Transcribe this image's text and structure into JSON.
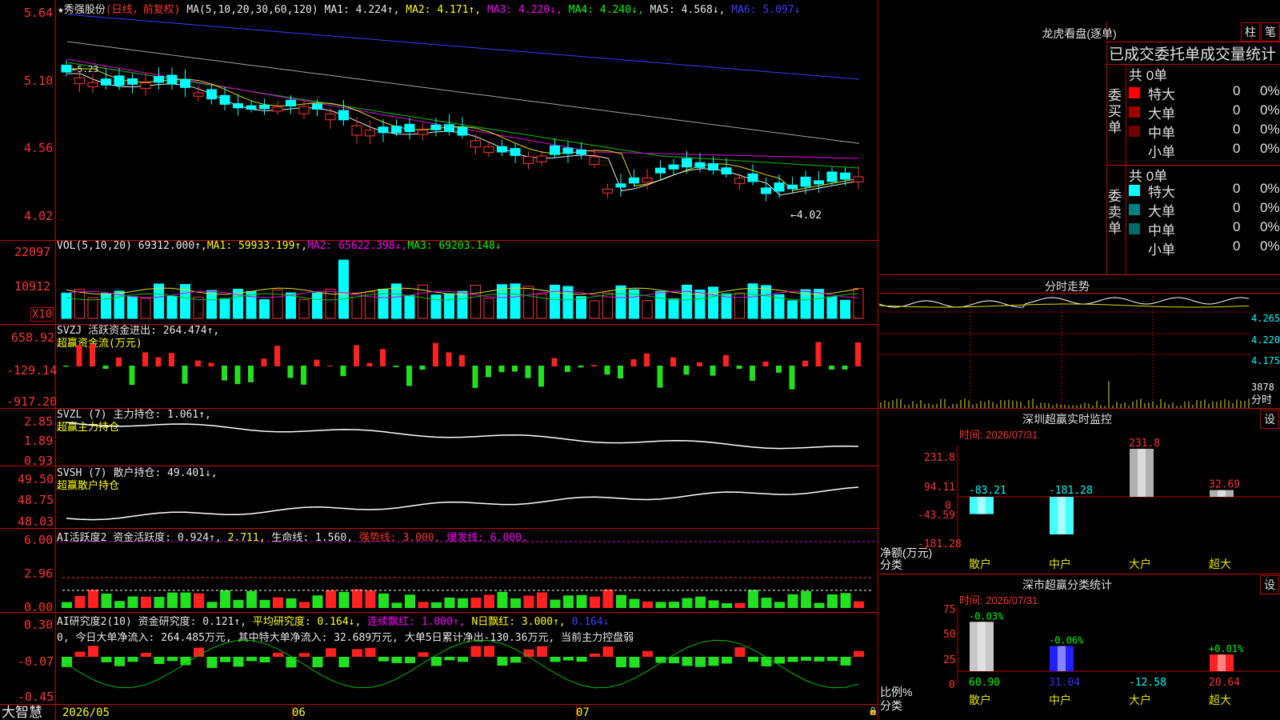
{
  "stock": {
    "name": "秀强股份",
    "mode": "(日线，前复权)",
    "ma_prefix": "MA(5,10,20,30,60,120)",
    "ma1": "MA1: 4.224↑,",
    "ma2": "MA2: 4.171↑,",
    "ma3": "MA3: 4.220↓,",
    "ma4": "MA4: 4.240↓,",
    "ma5": "MA5: 4.568↓,",
    "ma6": "MA6: 5.097↓",
    "arrow_label": "←4.02",
    "hi_label": "←5.23"
  },
  "price_axis": {
    "ticks": [
      "5.64",
      "5.10",
      "4.56",
      "4.02"
    ]
  },
  "vol": {
    "prefix": "VOL(5,10,20)",
    "value": "69312.000↑,",
    "ma1": "MA1: 59933.199↑,",
    "ma2": "MA2: 65622.398↓,",
    "ma3": "MA3: 69203.148↓",
    "ticks": [
      "22097",
      "10912"
    ],
    "unit": "X10"
  },
  "svzj": {
    "line1": "SVZJ  活跃资金进出: 264.474↑,",
    "line2": "超赢资金流(万元)",
    "ticks": [
      "658.92",
      "-129.14",
      "-917.20"
    ]
  },
  "svzl": {
    "line1": "SVZL (7) 主力持仓: 1.061↑,",
    "line2": "超赢主力持仓",
    "ticks": [
      "2.85",
      "1.89",
      "0.93"
    ]
  },
  "svsh": {
    "line1": "SVSH (7) 散户持仓: 49.401↓,",
    "line2": "超赢散户持仓",
    "ticks": [
      "49.50",
      "48.75",
      "48.03"
    ]
  },
  "ai1": {
    "a": "AI活跃度2 资金活跃度: 0.924↑,",
    "b": "2.711,",
    "c": "生命线: 1.560,",
    "d": "强势线: 3.000,",
    "e": "爆发线: 6.000,",
    "ticks": [
      "6.00",
      "2.96",
      "0.00"
    ]
  },
  "ai2": {
    "a": "AI研究度2(10) 资金研究度: 0.121↑,",
    "b": "平均研究度: 0.164↓,",
    "c": "连续飘红: 1.000↑,",
    "d": "N日飘红: 3.000↑,",
    "e": "0.164↓",
    "summary": "0, 今日大单净流入: 264.485万元, 其中特大单净流入: 32.689万元, 大单5日累计净出-130.36万元, 当前主力控盘弱",
    "ticks": [
      "0.30",
      "-0.07",
      "-0.45"
    ]
  },
  "dates": [
    "2026/05",
    "06",
    "07"
  ],
  "brand": "大智慧",
  "lhb": {
    "title": "龙虎看盘(逐单)",
    "btn1": "柱",
    "btn2": "笔",
    "header": "已成交委托单成交量统计",
    "buy_label": "委买单",
    "sell_label": "委卖单",
    "buy_total": "共 0单",
    "sell_total": "共 0单",
    "buy_rows": [
      {
        "name": "特大",
        "count": "0",
        "pct": "0%",
        "color": "#ff0000"
      },
      {
        "name": "大单",
        "count": "0",
        "pct": "0%",
        "color": "#a00000"
      },
      {
        "name": "中单",
        "count": "0",
        "pct": "0%",
        "color": "#700000"
      },
      {
        "name": "小单",
        "count": "0",
        "pct": "0%",
        "color": ""
      }
    ],
    "sell_rows": [
      {
        "name": "特大",
        "count": "0",
        "pct": "0%",
        "color": "#00ffff"
      },
      {
        "name": "大单",
        "count": "0",
        "pct": "0%",
        "color": "#008080"
      },
      {
        "name": "中单",
        "count": "0",
        "pct": "0%",
        "color": "#006868"
      },
      {
        "name": "小单",
        "count": "0",
        "pct": "0%",
        "color": ""
      }
    ]
  },
  "fenshi": {
    "title": "分时走势",
    "ticks": [
      "4.265",
      "4.220",
      "4.175"
    ],
    "vol": "3878",
    "vol_label": "分时"
  },
  "monitor": {
    "title": "深圳超赢实时监控",
    "btn": "设",
    "time": "时间: 2026/07/31",
    "ticks": [
      "231.8",
      "94.11",
      "0",
      "-43.59",
      "-181.28"
    ],
    "ylabel": "净额(万元)",
    "xlabel": "分类"
  },
  "classify": {
    "title": "深市超赢分类统计",
    "btn": "设",
    "time": "时间: 2026/07/31",
    "ticks": [
      "75",
      "50",
      "25",
      "0"
    ],
    "ylabel": "比例%",
    "xlabel": "分类"
  },
  "chart_data": [
    {
      "type": "bar",
      "title": "深圳超赢实时监控",
      "categories": [
        "散户",
        "中户",
        "大户",
        "超大"
      ],
      "values": [
        -83.21,
        -181.28,
        231.8,
        32.69
      ],
      "labels": [
        "-83.21",
        "-181.28",
        "231.8",
        "32.69"
      ],
      "ylim": [
        -181.28,
        231.8
      ],
      "ylabel": "净额(万元)",
      "xlabel": "分类"
    },
    {
      "type": "bar",
      "title": "深市超赢分类统计",
      "categories": [
        "散户",
        "中户",
        "大户",
        "超大"
      ],
      "values": [
        60.9,
        31.04,
        -12.58,
        20.64
      ],
      "change": [
        "-0.03%",
        "-0.06%",
        "",
        "+0.01%"
      ],
      "labels": [
        "60.90",
        "31.04",
        "-12.58",
        "20.64"
      ],
      "ylim": [
        0,
        75
      ],
      "ylabel": "比例%",
      "xlabel": "分类"
    }
  ]
}
